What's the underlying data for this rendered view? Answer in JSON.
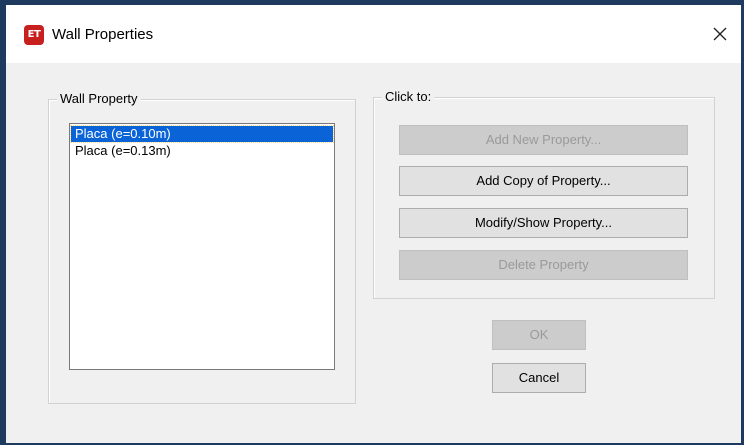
{
  "window": {
    "icon_text": "ET",
    "title": "Wall Properties"
  },
  "wall_property": {
    "caption": "Wall Property",
    "items": [
      {
        "label": "Placa (e=0.10m)",
        "selected": true
      },
      {
        "label": "Placa (e=0.13m)",
        "selected": false
      }
    ]
  },
  "click_to": {
    "caption": "Click to:",
    "add_new": "Add New Property...",
    "add_copy": "Add Copy of Property...",
    "modify_show": "Modify/Show Property...",
    "delete": "Delete Property"
  },
  "dialog": {
    "ok": "OK",
    "cancel": "Cancel"
  },
  "colors": {
    "frame": "#1f3a5f",
    "selection": "#0a64d8",
    "app_icon": "#c8201f"
  }
}
